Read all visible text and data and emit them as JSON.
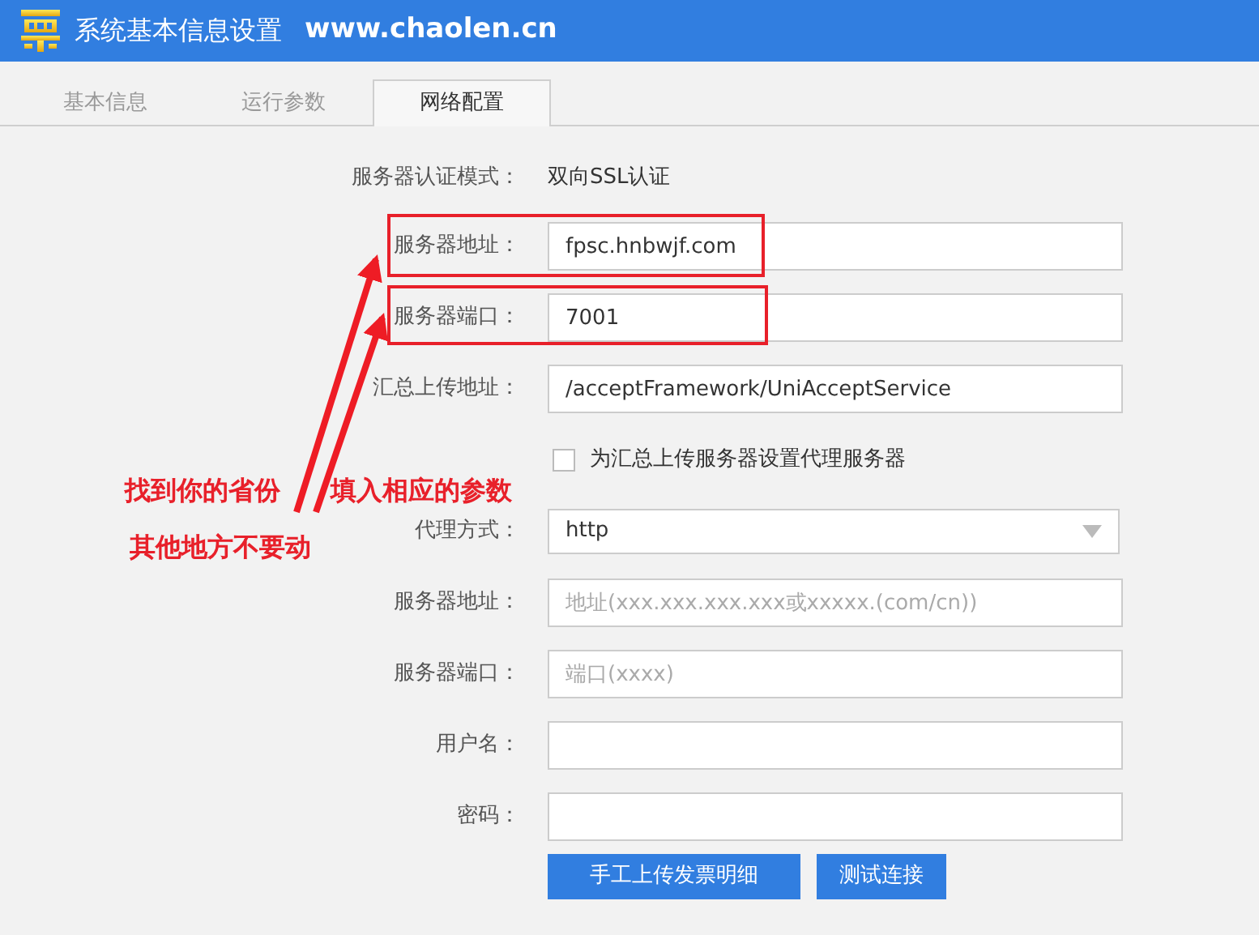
{
  "window": {
    "title": "系统基本信息设置",
    "site": "www.chaolen.cn"
  },
  "tabs": [
    {
      "label": "基本信息",
      "selected": false
    },
    {
      "label": "运行参数",
      "selected": false
    },
    {
      "label": "网络配置",
      "selected": true
    }
  ],
  "form": {
    "rows": [
      {
        "kind": "text",
        "label": "服务器认证模式：",
        "value": "双向SSL认证"
      },
      {
        "kind": "input",
        "label": "服务器地址：",
        "value": "fpsc.hnbwjf.com"
      },
      {
        "kind": "input",
        "label": "服务器端口：",
        "value": "7001"
      },
      {
        "kind": "input",
        "label": "汇总上传地址：",
        "value": "/acceptFramework/UniAcceptService"
      },
      {
        "kind": "checkbox",
        "label": "为汇总上传服务器设置代理服务器",
        "checked": false
      },
      {
        "kind": "select",
        "label": "代理方式：",
        "value": "http"
      },
      {
        "kind": "input",
        "label": "服务器地址：",
        "placeholder": "地址(xxx.xxx.xxx.xxx或xxxxx.(com/cn))"
      },
      {
        "kind": "input",
        "label": "服务器端口：",
        "placeholder": "端口(xxxx)"
      },
      {
        "kind": "input",
        "label": "用户名："
      },
      {
        "kind": "input",
        "label": "密码："
      }
    ],
    "buttons": [
      "手工上传发票明细",
      "测试连接"
    ]
  },
  "annotations": {
    "texts": [
      "找到你的省份",
      "填入相应的参数",
      "其他地方不要动"
    ]
  }
}
